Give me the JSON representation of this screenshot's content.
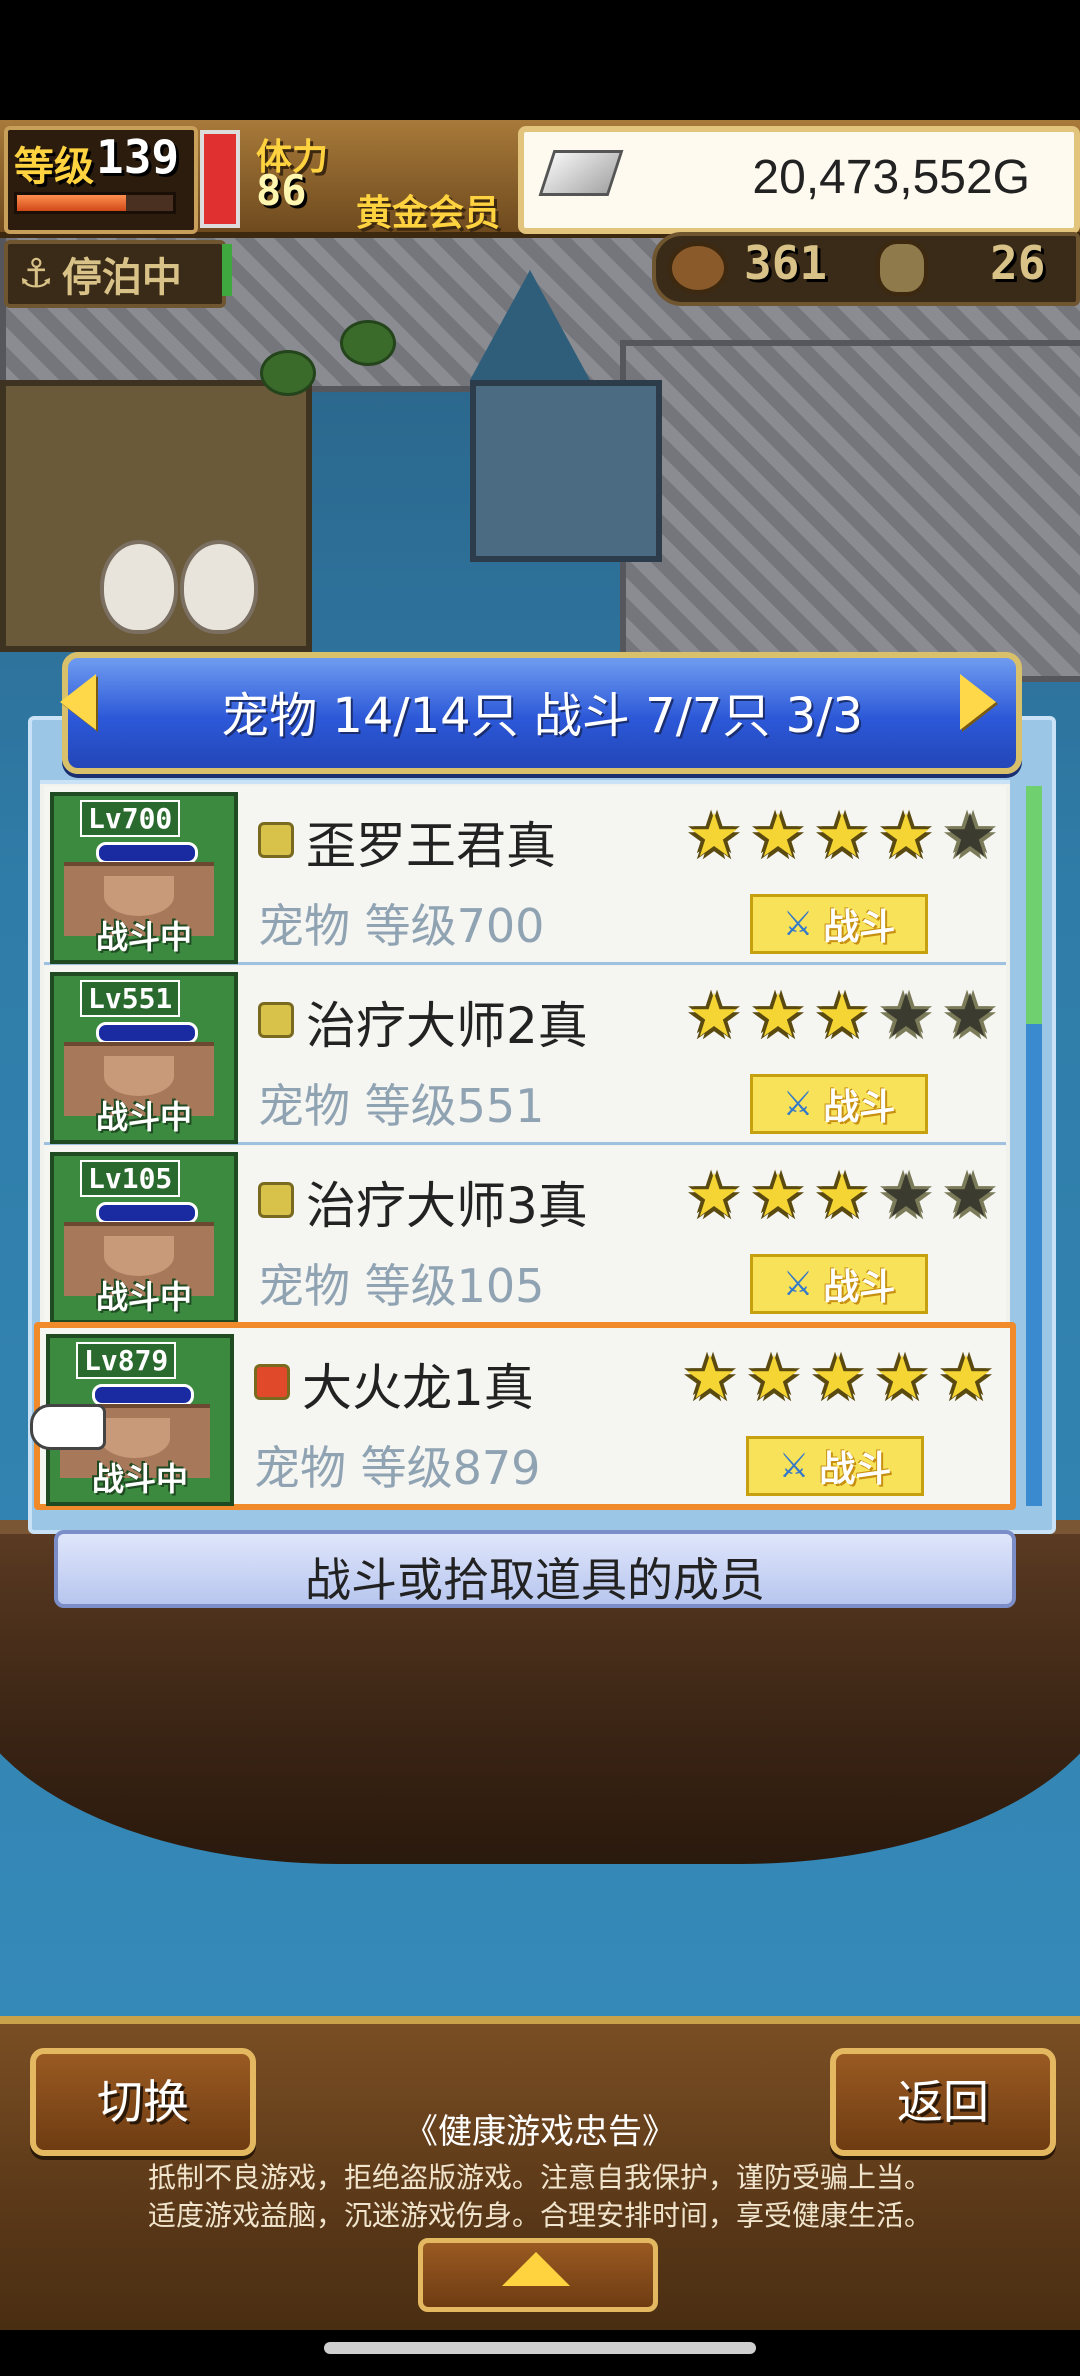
{
  "hud": {
    "level_label": "等级",
    "level_value": "139",
    "level_exp_fraction": 0.7,
    "stamina_label": "体力",
    "stamina_value": "86",
    "stamina_fraction": 1.0,
    "member_rank": "黄金会员",
    "money": "20,473,552G",
    "anchor_status": "停泊中",
    "resource1_value": "361",
    "resource2_value": "26"
  },
  "panel": {
    "title": "宠物 14/14只 战斗 7/7只  3/3",
    "hint": "战斗或拾取道具的成员",
    "scroll_fraction": 0.33
  },
  "pets": [
    {
      "lv_badge": "Lv700",
      "status": "战斗中",
      "name": "歪罗王君真",
      "info": "宠物 等级700",
      "stars": 4,
      "max_stars": 5,
      "element_color": "#d8c24a",
      "fight_label": "战斗",
      "selected": false
    },
    {
      "lv_badge": "Lv551",
      "status": "战斗中",
      "name": "治疗大师2真",
      "info": "宠物 等级551",
      "stars": 3,
      "max_stars": 5,
      "element_color": "#d8c24a",
      "fight_label": "战斗",
      "selected": false
    },
    {
      "lv_badge": "Lv105",
      "status": "战斗中",
      "name": "治疗大师3真",
      "info": "宠物 等级105",
      "stars": 3,
      "max_stars": 5,
      "element_color": "#d8c24a",
      "fight_label": "战斗",
      "selected": false
    },
    {
      "lv_badge": "Lv879",
      "status": "战斗中",
      "name": "大火龙1真",
      "info": "宠物 等级879",
      "stars": 5,
      "max_stars": 5,
      "element_color": "#e04a2a",
      "fight_label": "战斗",
      "selected": true
    }
  ],
  "bottom": {
    "switch_label": "切换",
    "back_label": "返回",
    "notice_title": "《健康游戏忠告》",
    "notice_line1": "抵制不良游戏，拒绝盗版游戏。注意自我保护，谨防受骗上当。",
    "notice_line2": "适度游戏益脑，沉迷游戏伤身。合理安排时间，享受健康生活。"
  },
  "icons": {
    "anchor": "anchor-icon",
    "star": "star-icon",
    "sword": "sword-icon",
    "up_arrow": "up-arrow-icon"
  }
}
